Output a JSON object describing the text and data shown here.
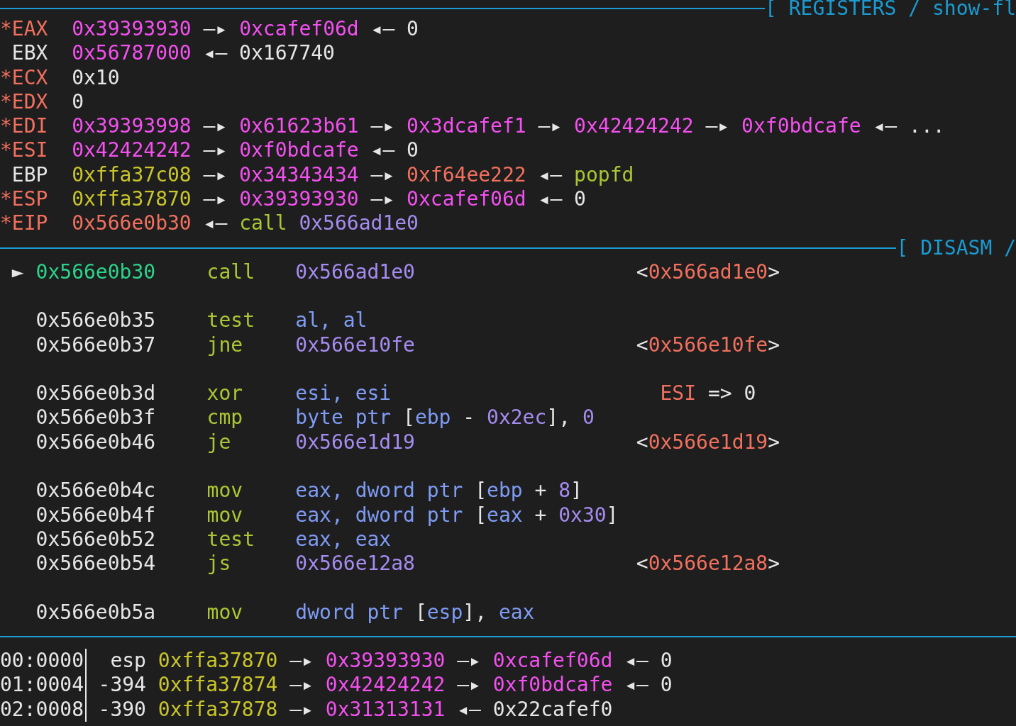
{
  "registers": {
    "title": "[ REGISTERS / show-fl",
    "rows": [
      {
        "flag": "*",
        "name": "EAX",
        "modified": true,
        "chain": [
          {
            "kind": "heap",
            "text": "0x39393930"
          },
          {
            "kind": "arrow",
            "text": "—▸"
          },
          {
            "kind": "heap",
            "text": "0xcafef06d"
          },
          {
            "kind": "arrow",
            "text": "◂—"
          },
          {
            "kind": "plain",
            "text": "0"
          }
        ]
      },
      {
        "name": "EBX",
        "modified": false,
        "chain": [
          {
            "kind": "heap",
            "text": "0x56787000"
          },
          {
            "kind": "arrow",
            "text": "◂—"
          },
          {
            "kind": "plain",
            "text": "0x167740"
          }
        ]
      },
      {
        "flag": "*",
        "name": "ECX",
        "modified": true,
        "chain": [
          {
            "kind": "plain",
            "text": "0x10"
          }
        ]
      },
      {
        "flag": "*",
        "name": "EDX",
        "modified": true,
        "chain": [
          {
            "kind": "plain",
            "text": "0"
          }
        ]
      },
      {
        "flag": "*",
        "name": "EDI",
        "modified": true,
        "chain": [
          {
            "kind": "heap",
            "text": "0x39393998"
          },
          {
            "kind": "arrow",
            "text": "—▸"
          },
          {
            "kind": "heap",
            "text": "0x61623b61"
          },
          {
            "kind": "arrow",
            "text": "—▸"
          },
          {
            "kind": "heap",
            "text": "0x3dcafef1"
          },
          {
            "kind": "arrow",
            "text": "—▸"
          },
          {
            "kind": "heap",
            "text": "0x42424242"
          },
          {
            "kind": "arrow",
            "text": "—▸"
          },
          {
            "kind": "heap",
            "text": "0xf0bdcafe"
          },
          {
            "kind": "arrow",
            "text": "◂—"
          },
          {
            "kind": "plain",
            "text": "..."
          }
        ]
      },
      {
        "flag": "*",
        "name": "ESI",
        "modified": true,
        "chain": [
          {
            "kind": "heap",
            "text": "0x42424242"
          },
          {
            "kind": "arrow",
            "text": "—▸"
          },
          {
            "kind": "heap",
            "text": "0xf0bdcafe"
          },
          {
            "kind": "arrow",
            "text": "◂—"
          },
          {
            "kind": "plain",
            "text": "0"
          }
        ]
      },
      {
        "name": "EBP",
        "modified": false,
        "chain": [
          {
            "kind": "stack",
            "text": "0xffa37c08"
          },
          {
            "kind": "arrow",
            "text": "—▸"
          },
          {
            "kind": "heap",
            "text": "0x34343434"
          },
          {
            "kind": "arrow",
            "text": "—▸"
          },
          {
            "kind": "code",
            "text": "0xf64ee222"
          },
          {
            "kind": "arrow",
            "text": "◂—"
          },
          {
            "kind": "mnemonic",
            "text": "popfd"
          }
        ]
      },
      {
        "flag": "*",
        "name": "ESP",
        "modified": true,
        "chain": [
          {
            "kind": "stack",
            "text": "0xffa37870"
          },
          {
            "kind": "arrow",
            "text": "—▸"
          },
          {
            "kind": "heap",
            "text": "0x39393930"
          },
          {
            "kind": "arrow",
            "text": "—▸"
          },
          {
            "kind": "heap",
            "text": "0xcafef06d"
          },
          {
            "kind": "arrow",
            "text": "◂—"
          },
          {
            "kind": "plain",
            "text": "0"
          }
        ]
      },
      {
        "flag": "*",
        "name": "EIP",
        "modified": true,
        "chain": [
          {
            "kind": "code",
            "text": "0x566e0b30"
          },
          {
            "kind": "arrow",
            "text": "◂—"
          },
          {
            "kind": "mnemonic",
            "text": "call"
          },
          {
            "kind": "imm",
            "text": "0x566ad1e0"
          }
        ]
      }
    ]
  },
  "disasm": {
    "title": "[ DISASM /",
    "groups": [
      [
        {
          "kind": "target",
          "marker": "►",
          "current": true,
          "address": "0x566e0b30",
          "mnemonic": "call",
          "operands": [
            {
              "kind": "imm",
              "text": "0x566ad1e0"
            }
          ],
          "comment": [
            {
              "kind": "plain",
              "text": "<"
            },
            {
              "kind": "code",
              "text": "0x566ad1e0"
            },
            {
              "kind": "plain",
              "text": ">"
            }
          ]
        }
      ],
      [
        {
          "kind": "plain",
          "current": false,
          "address": "0x566e0b35",
          "mnemonic": "test",
          "operands": [
            {
              "kind": "reg",
              "text": "al,"
            },
            {
              "kind": "reg",
              "text": "al",
              "spaced": true
            }
          ]
        },
        {
          "kind": "target",
          "current": false,
          "address": "0x566e0b37",
          "mnemonic": "jne",
          "operands": [
            {
              "kind": "imm",
              "text": "0x566e10fe"
            }
          ],
          "comment": [
            {
              "kind": "plain",
              "text": "<"
            },
            {
              "kind": "code",
              "text": "0x566e10fe"
            },
            {
              "kind": "plain",
              "text": ">"
            }
          ]
        }
      ],
      [
        {
          "kind": "effect",
          "current": false,
          "address": "0x566e0b3d",
          "mnemonic": "xor",
          "operands": [
            {
              "kind": "reg",
              "text": "esi,"
            },
            {
              "kind": "reg",
              "text": "esi",
              "spaced": true
            }
          ],
          "comment": [
            {
              "kind": "code",
              "text": "ESI"
            },
            {
              "kind": "plain",
              "text": "=>",
              "spaced": true
            },
            {
              "kind": "plain",
              "text": "0",
              "spaced": true
            }
          ]
        },
        {
          "kind": "plain",
          "current": false,
          "address": "0x566e0b3f",
          "mnemonic": "cmp",
          "operands": [
            {
              "kind": "reg",
              "text": "byte ptr"
            },
            {
              "kind": "plain",
              "text": "[",
              "spaced": true
            },
            {
              "kind": "reg",
              "text": "ebp"
            },
            {
              "kind": "plain",
              "text": "-",
              "spaced": true
            },
            {
              "kind": "imm",
              "text": "0x2ec",
              "spaced": true
            },
            {
              "kind": "plain",
              "text": "],"
            },
            {
              "kind": "imm",
              "text": "0",
              "spaced": true
            }
          ]
        },
        {
          "kind": "target",
          "current": false,
          "address": "0x566e0b46",
          "mnemonic": "je",
          "operands": [
            {
              "kind": "imm",
              "text": "0x566e1d19"
            }
          ],
          "comment": [
            {
              "kind": "plain",
              "text": "<"
            },
            {
              "kind": "code",
              "text": "0x566e1d19"
            },
            {
              "kind": "plain",
              "text": ">"
            }
          ]
        }
      ],
      [
        {
          "kind": "plain",
          "current": false,
          "address": "0x566e0b4c",
          "mnemonic": "mov",
          "operands": [
            {
              "kind": "reg",
              "text": "eax,"
            },
            {
              "kind": "reg",
              "text": "dword ptr",
              "spaced": true
            },
            {
              "kind": "plain",
              "text": "[",
              "spaced": true
            },
            {
              "kind": "reg",
              "text": "ebp"
            },
            {
              "kind": "plain",
              "text": "+",
              "spaced": true
            },
            {
              "kind": "imm",
              "text": "8",
              "spaced": true
            },
            {
              "kind": "plain",
              "text": "]"
            }
          ]
        },
        {
          "kind": "plain",
          "current": false,
          "address": "0x566e0b4f",
          "mnemonic": "mov",
          "operands": [
            {
              "kind": "reg",
              "text": "eax,"
            },
            {
              "kind": "reg",
              "text": "dword ptr",
              "spaced": true
            },
            {
              "kind": "plain",
              "text": "[",
              "spaced": true
            },
            {
              "kind": "reg",
              "text": "eax"
            },
            {
              "kind": "plain",
              "text": "+",
              "spaced": true
            },
            {
              "kind": "imm",
              "text": "0x30",
              "spaced": true
            },
            {
              "kind": "plain",
              "text": "]"
            }
          ]
        },
        {
          "kind": "plain",
          "current": false,
          "address": "0x566e0b52",
          "mnemonic": "test",
          "operands": [
            {
              "kind": "reg",
              "text": "eax,"
            },
            {
              "kind": "reg",
              "text": "eax",
              "spaced": true
            }
          ]
        },
        {
          "kind": "target",
          "current": false,
          "address": "0x566e0b54",
          "mnemonic": "js",
          "operands": [
            {
              "kind": "imm",
              "text": "0x566e12a8"
            }
          ],
          "comment": [
            {
              "kind": "plain",
              "text": "<"
            },
            {
              "kind": "code",
              "text": "0x566e12a8"
            },
            {
              "kind": "plain",
              "text": ">"
            }
          ]
        }
      ],
      [
        {
          "kind": "plain",
          "current": false,
          "address": "0x566e0b5a",
          "mnemonic": "mov",
          "operands": [
            {
              "kind": "reg",
              "text": "dword ptr"
            },
            {
              "kind": "plain",
              "text": "[",
              "spaced": true
            },
            {
              "kind": "reg",
              "text": "esp"
            },
            {
              "kind": "plain",
              "text": "],"
            },
            {
              "kind": "reg",
              "text": "eax",
              "spaced": true
            }
          ]
        }
      ]
    ]
  },
  "stack": {
    "rows": [
      {
        "index": "00:0000",
        "label": "esp",
        "chain": [
          {
            "kind": "stack",
            "text": "0xffa37870"
          },
          {
            "kind": "arrow",
            "text": "—▸"
          },
          {
            "kind": "heap",
            "text": "0x39393930"
          },
          {
            "kind": "arrow",
            "text": "—▸"
          },
          {
            "kind": "heap",
            "text": "0xcafef06d"
          },
          {
            "kind": "arrow",
            "text": "◂—"
          },
          {
            "kind": "plain",
            "text": "0"
          }
        ]
      },
      {
        "index": "01:0004",
        "label": "-394",
        "chain": [
          {
            "kind": "stack",
            "text": "0xffa37874"
          },
          {
            "kind": "arrow",
            "text": "—▸"
          },
          {
            "kind": "heap",
            "text": "0x42424242"
          },
          {
            "kind": "arrow",
            "text": "—▸"
          },
          {
            "kind": "heap",
            "text": "0xf0bdcafe"
          },
          {
            "kind": "arrow",
            "text": "◂—"
          },
          {
            "kind": "plain",
            "text": "0"
          }
        ]
      },
      {
        "index": "02:0008",
        "label": "-390",
        "chain": [
          {
            "kind": "stack",
            "text": "0xffa37878"
          },
          {
            "kind": "arrow",
            "text": "—▸"
          },
          {
            "kind": "heap",
            "text": "0x31313131"
          },
          {
            "kind": "arrow",
            "text": "◂—"
          },
          {
            "kind": "plain",
            "text": "0x22cafef0"
          }
        ]
      }
    ]
  }
}
